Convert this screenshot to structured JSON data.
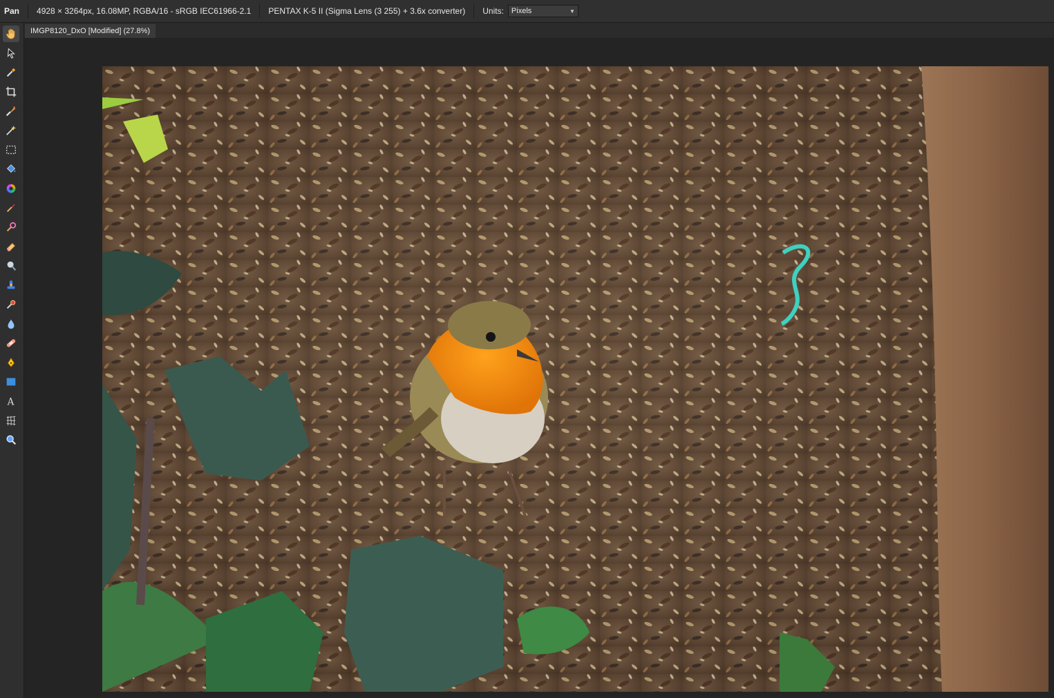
{
  "context_bar": {
    "tool_name": "Pan",
    "image_info": "4928 × 3264px, 16.08MP, RGBA/16 - sRGB IEC61966-2.1",
    "camera_info": "PENTAX K-5 II (Sigma Lens (3 255) + 3.6x converter)",
    "units_label": "Units:",
    "units_value": "Pixels"
  },
  "document": {
    "tab_title": "IMGP8120_DxO [Modified] (27.8%)"
  },
  "tools": [
    {
      "name": "hand-tool-icon",
      "active": true
    },
    {
      "name": "move-tool-icon"
    },
    {
      "name": "color-picker-icon"
    },
    {
      "name": "crop-tool-icon"
    },
    {
      "name": "selection-brush-icon"
    },
    {
      "name": "flood-select-icon"
    },
    {
      "name": "rectangular-marquee-icon"
    },
    {
      "name": "flood-fill-icon"
    },
    {
      "name": "gradient-tool-icon"
    },
    {
      "name": "paint-brush-icon"
    },
    {
      "name": "color-replacement-icon"
    },
    {
      "name": "erase-brush-icon"
    },
    {
      "name": "dodge-brush-icon"
    },
    {
      "name": "clone-brush-icon"
    },
    {
      "name": "red-eye-icon"
    },
    {
      "name": "blur-brush-icon"
    },
    {
      "name": "healing-brush-icon"
    },
    {
      "name": "pen-tool-icon"
    },
    {
      "name": "rectangle-tool-icon"
    },
    {
      "name": "artistic-text-icon"
    },
    {
      "name": "mesh-warp-icon"
    },
    {
      "name": "zoom-tool-icon"
    }
  ],
  "canvas": {
    "subject": "European robin on wood chips and seeds with ivy leaves"
  }
}
